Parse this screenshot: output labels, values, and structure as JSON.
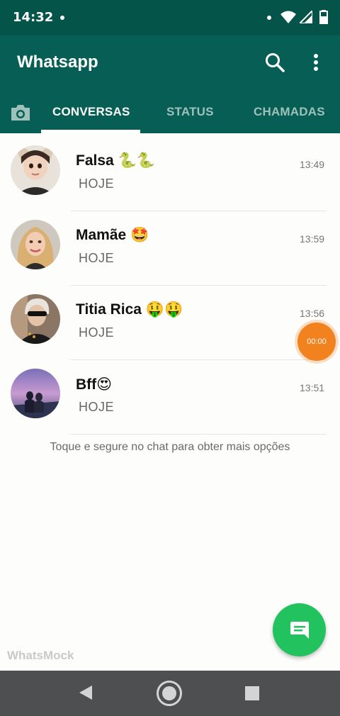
{
  "status_bar": {
    "time": "14:32"
  },
  "app": {
    "title": "Whatsapp"
  },
  "tabs": [
    {
      "label": "CONVERSAS"
    },
    {
      "label": "STATUS"
    },
    {
      "label": "CHAMADAS"
    }
  ],
  "chats": [
    {
      "name": "Falsa 🐍🐍",
      "subtitle": "HOJE",
      "time": "13:49"
    },
    {
      "name": "Mamãe 🤩",
      "subtitle": "HOJE",
      "time": "13:59"
    },
    {
      "name": "Titia Rica 🤑🤑",
      "subtitle": "HOJE",
      "time": "13:56"
    },
    {
      "name": "Bff😍",
      "subtitle": "HOJE",
      "time": "13:51"
    }
  ],
  "hint": "Toque e segure no chat para obter mais opções",
  "timer": "00:00",
  "watermark": "WhatsMock",
  "icons": {
    "status": [
      "notification-dot-icon",
      "wifi-icon",
      "signal-icon",
      "battery-icon"
    ],
    "appbar": [
      "search-icon",
      "more-vert-icon",
      "camera-icon"
    ],
    "fab": "new-chat-icon",
    "nav": [
      "back-icon",
      "home-icon",
      "recents-icon"
    ]
  },
  "colors": {
    "header": "#075e54",
    "statusbar": "#05544a",
    "fab": "#22c35e",
    "timer": "#f2821e"
  }
}
